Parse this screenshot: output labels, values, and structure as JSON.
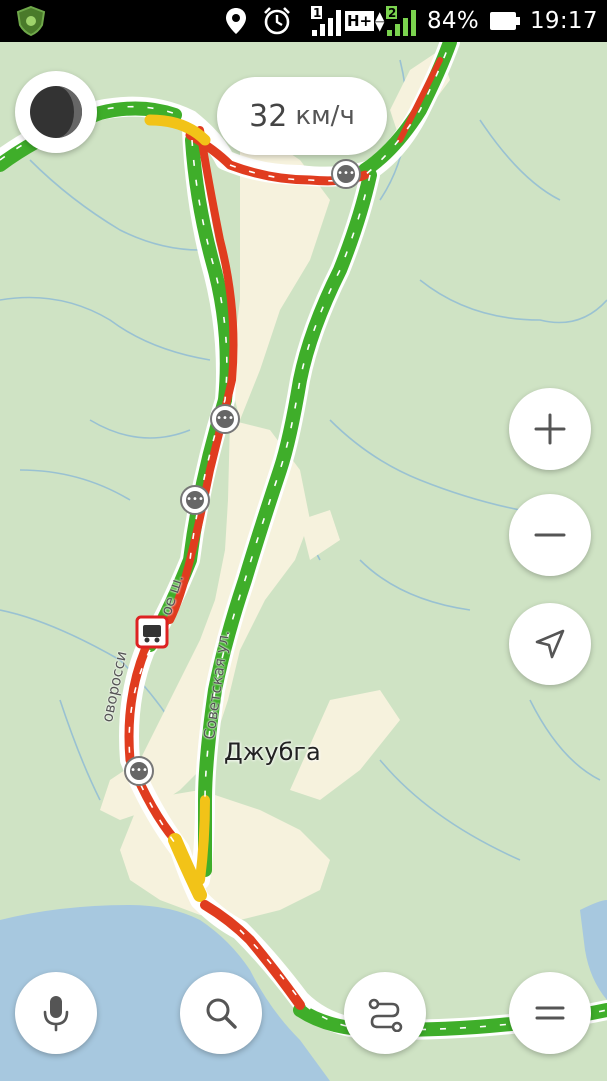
{
  "status_bar": {
    "battery_percent": "84%",
    "time": "19:17",
    "signal_1_label": "1",
    "signal_2_label": "2",
    "network_type": "H+",
    "icons": [
      "app-shield-icon",
      "location-pin-icon",
      "alarm-clock-icon",
      "signal-icon",
      "battery-icon"
    ]
  },
  "speed": {
    "value": "32",
    "unit": "км/ч"
  },
  "map": {
    "town_label": "Джубга",
    "street_labels": [
      {
        "name": "street-label-novorossiyskoe",
        "text": "оворосси"
      },
      {
        "name": "street-label-novorossiyskoe-tail",
        "text": "ое ш."
      },
      {
        "name": "street-label-sovetskaya",
        "text": "Советская ул."
      }
    ],
    "traffic_colors": {
      "free": "#3fae2a",
      "slow": "#f2c318",
      "jam": "#e03c1f",
      "water": "#a7c8df",
      "land": "#cfe3c4",
      "town": "#f6f2dd"
    }
  },
  "controls": {
    "zoom_in": "plus-icon",
    "zoom_out": "minus-icon",
    "locate": "navigation-arrow-icon",
    "voice": "microphone-icon",
    "search": "search-icon",
    "routes": "route-icon",
    "menu": "menu-icon"
  }
}
